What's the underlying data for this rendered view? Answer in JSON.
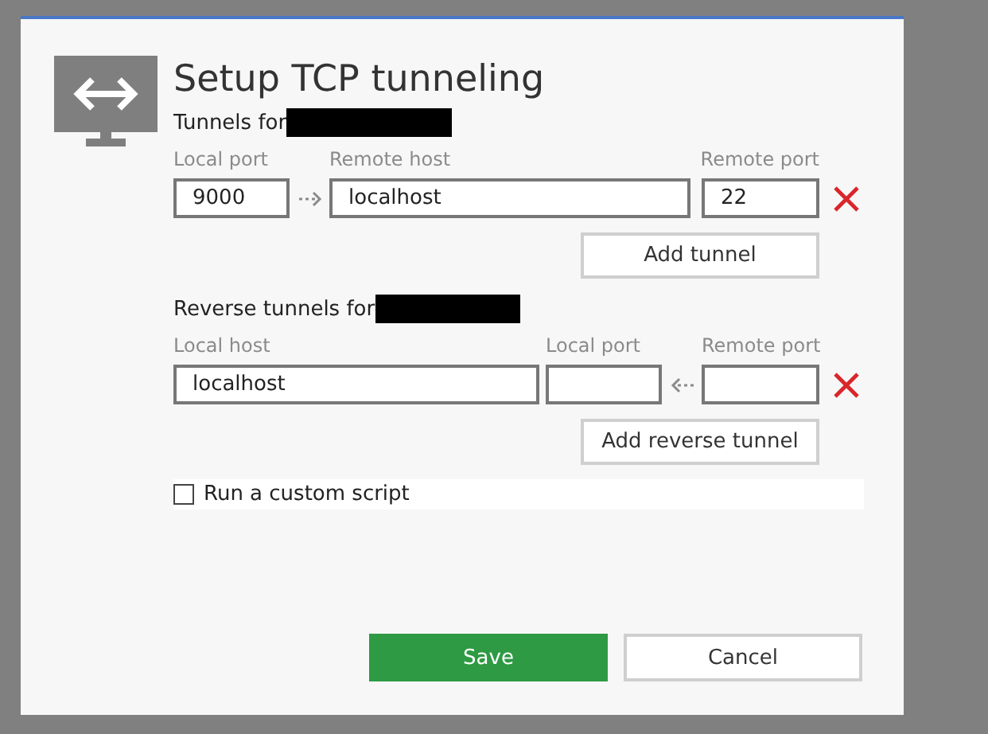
{
  "dialog": {
    "title": "Setup TCP tunneling",
    "tunnels": {
      "heading": "Tunnels for",
      "columns": [
        "Local port",
        "Remote host",
        "Remote port"
      ],
      "rows": [
        {
          "local_port": "9000",
          "remote_host": "localhost",
          "remote_port": "22"
        }
      ],
      "add_button": "Add tunnel"
    },
    "reverse_tunnels": {
      "heading": "Reverse tunnels for",
      "columns": [
        "Local host",
        "Local port",
        "Remote port"
      ],
      "rows": [
        {
          "local_host": "localhost"
        }
      ],
      "add_button": "Add reverse tunnel"
    },
    "custom_script": {
      "label": "Run a custom script",
      "checked": false
    },
    "buttons": [
      {
        "label": "Save",
        "kind": "primary"
      },
      {
        "label": "Cancel",
        "kind": "secondary"
      }
    ]
  }
}
